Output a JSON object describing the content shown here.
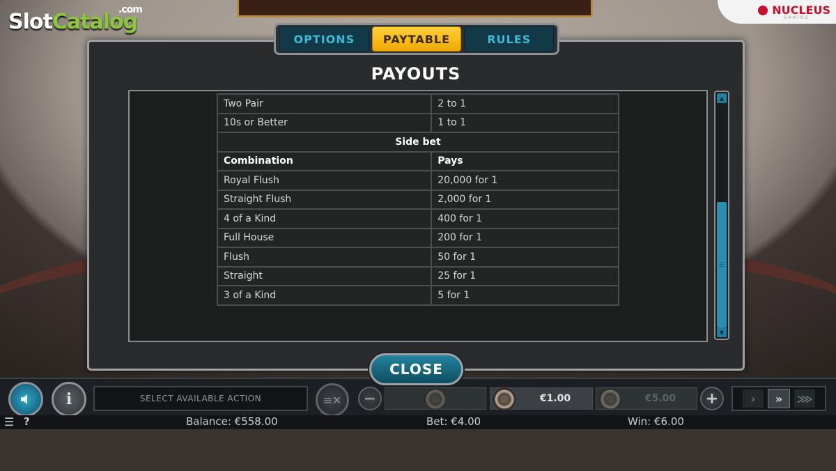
{
  "branding": {
    "watermark_slot": "Slot",
    "watermark_catalog": "Catalog",
    "watermark_com": ".com",
    "provider": "NUCLEUS",
    "provider_sub": "GAMING"
  },
  "dialog": {
    "tabs": [
      {
        "label": "OPTIONS",
        "active": false
      },
      {
        "label": "PAYTABLE",
        "active": true
      },
      {
        "label": "RULES",
        "active": false
      }
    ],
    "title": "PAYOUTS",
    "close_label": "CLOSE"
  },
  "paytable": {
    "top_rows": [
      {
        "hand": "Two Pair",
        "pays": "2 to 1"
      },
      {
        "hand": "10s or Better",
        "pays": "1 to 1"
      }
    ],
    "side_bet_label": "Side bet",
    "side_bet_headers": {
      "hand": "Combination",
      "pays": "Pays"
    },
    "side_bet_rows": [
      {
        "hand": "Royal Flush",
        "pays": "20,000 for 1"
      },
      {
        "hand": "Straight Flush",
        "pays": "2,000 for 1"
      },
      {
        "hand": "4 of a Kind",
        "pays": "400 for 1"
      },
      {
        "hand": "Full House",
        "pays": "200 for 1"
      },
      {
        "hand": "Flush",
        "pays": "50 for 1"
      },
      {
        "hand": "Straight",
        "pays": "25 for 1"
      },
      {
        "hand": "3 of a Kind",
        "pays": "5 for 1"
      }
    ]
  },
  "controls": {
    "action_text": "SELECT AVAILABLE ACTION",
    "chips": [
      {
        "label": "€1.00",
        "selected": true
      },
      {
        "label": "€5.00",
        "selected": false
      }
    ],
    "speed_levels": 3,
    "speed_selected": 2
  },
  "status": {
    "balance": "Balance: €558.00",
    "bet": "Bet: €4.00",
    "win": "Win: €6.00",
    "help": "?"
  },
  "colors": {
    "accent": "#f0a900",
    "teal": "#1f7f9c",
    "watermark_green": "#8cc63f"
  }
}
